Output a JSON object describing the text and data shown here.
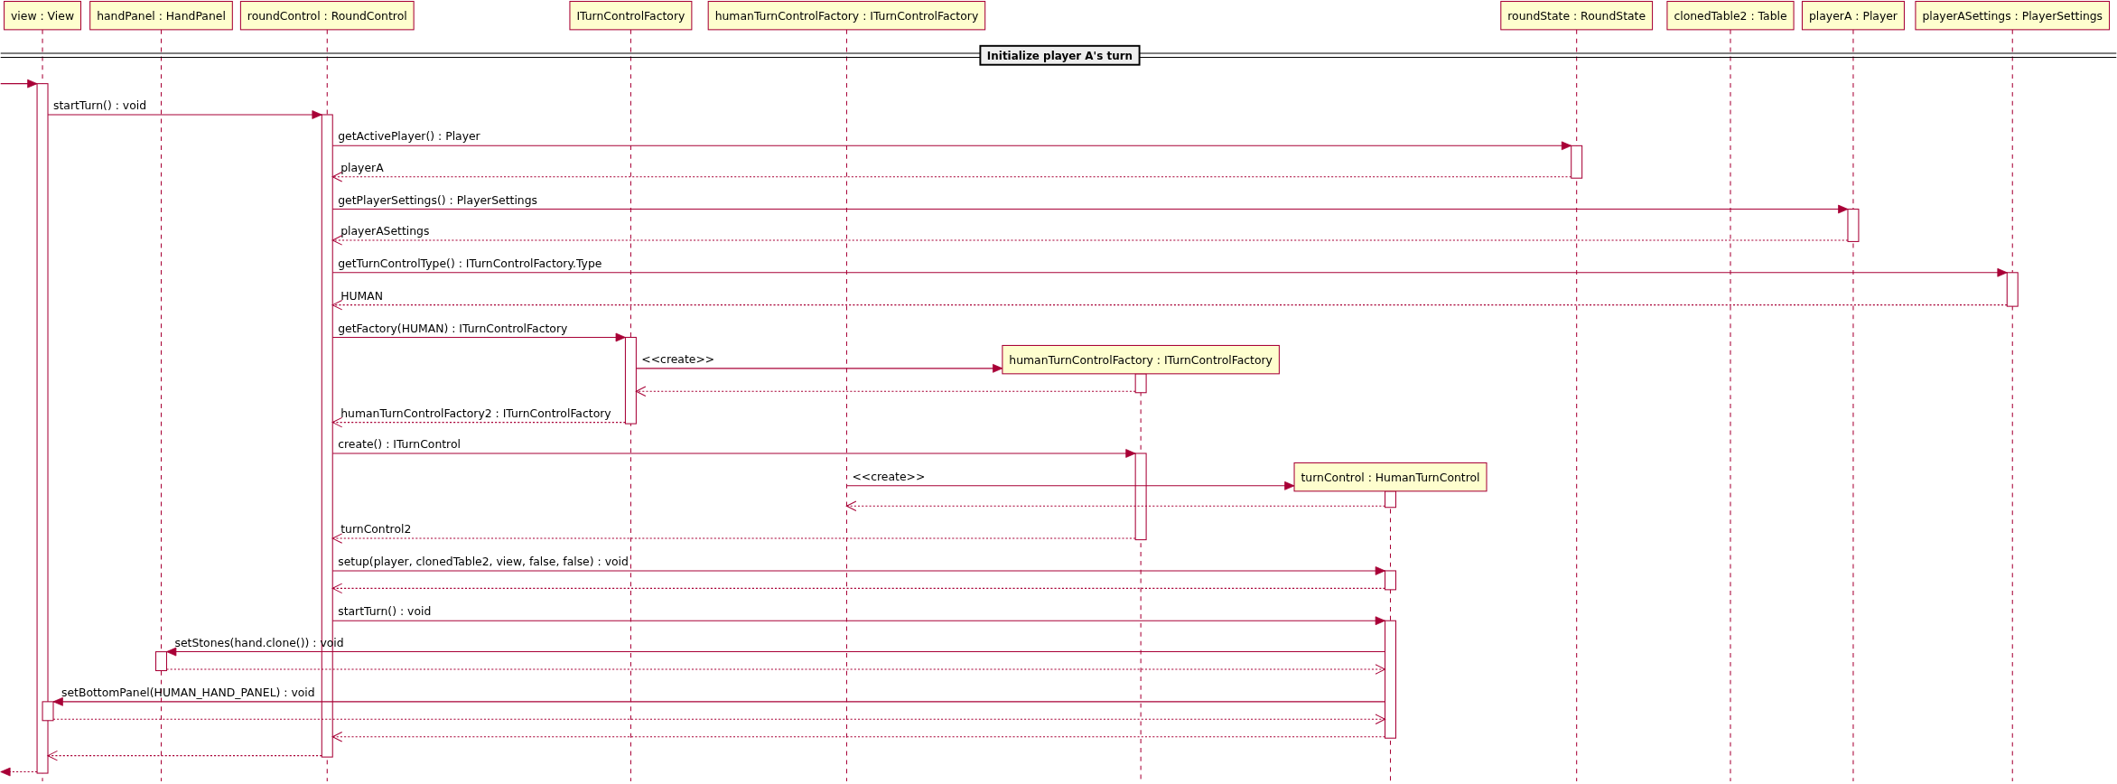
{
  "participants": [
    {
      "label": "view : View"
    },
    {
      "label": "handPanel : HandPanel"
    },
    {
      "label": "roundControl : RoundControl"
    },
    {
      "label": "ITurnControlFactory"
    },
    {
      "label": "humanTurnControlFactory : ITurnControlFactory"
    },
    {
      "label": "roundState : RoundState"
    },
    {
      "label": "clonedTable2 : Table"
    },
    {
      "label": "playerA : Player"
    },
    {
      "label": "playerASettings : PlayerSettings"
    },
    {
      "label": "humanTurnControlFactory : ITurnControlFactory"
    },
    {
      "label": "turnControl : HumanTurnControl"
    }
  ],
  "section": {
    "title": "Initialize player A's turn"
  },
  "messages": [
    {
      "kind": "found"
    },
    {
      "kind": "call",
      "label": "startTurn() : void"
    },
    {
      "kind": "call",
      "label": "getActivePlayer() : Player"
    },
    {
      "kind": "return",
      "label": "playerA"
    },
    {
      "kind": "call",
      "label": "getPlayerSettings() : PlayerSettings"
    },
    {
      "kind": "return",
      "label": "playerASettings"
    },
    {
      "kind": "call",
      "label": "getTurnControlType() : ITurnControlFactory.Type"
    },
    {
      "kind": "return",
      "label": "HUMAN"
    },
    {
      "kind": "call",
      "label": "getFactory(HUMAN) : ITurnControlFactory"
    },
    {
      "kind": "create",
      "label": "<<create>>"
    },
    {
      "kind": "return"
    },
    {
      "kind": "return",
      "label": "humanTurnControlFactory2 : ITurnControlFactory"
    },
    {
      "kind": "call",
      "label": "create() : ITurnControl"
    },
    {
      "kind": "create",
      "label": "<<create>>"
    },
    {
      "kind": "return"
    },
    {
      "kind": "return",
      "label": "turnControl2"
    },
    {
      "kind": "call",
      "label": "setup(player, clonedTable2, view, false, false) : void"
    },
    {
      "kind": "return"
    },
    {
      "kind": "call",
      "label": "startTurn() : void"
    },
    {
      "kind": "call",
      "label": "setStones(hand.clone()) : void"
    },
    {
      "kind": "return"
    },
    {
      "kind": "call",
      "label": "setBottomPanel(HUMAN_HAND_PANEL) : void"
    },
    {
      "kind": "return"
    },
    {
      "kind": "return"
    },
    {
      "kind": "return"
    },
    {
      "kind": "lost"
    }
  ]
}
